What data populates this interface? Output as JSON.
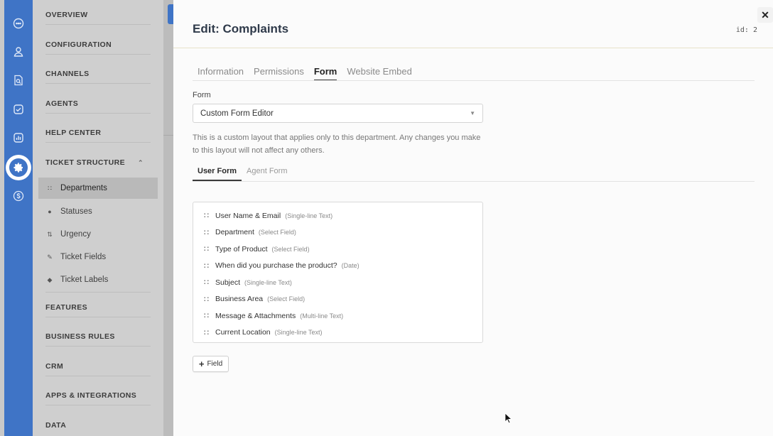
{
  "nav": {
    "sections": [
      {
        "label": "OVERVIEW"
      },
      {
        "label": "CONFIGURATION"
      },
      {
        "label": "CHANNELS"
      },
      {
        "label": "AGENTS"
      },
      {
        "label": "HELP CENTER"
      },
      {
        "label": "TICKET STRUCTURE",
        "expanded": true
      },
      {
        "label": "FEATURES"
      },
      {
        "label": "BUSINESS RULES"
      },
      {
        "label": "CRM"
      },
      {
        "label": "APPS & INTEGRATIONS"
      },
      {
        "label": "DATA"
      }
    ],
    "ticket_structure_items": [
      {
        "label": "Departments",
        "icon": "grid-icon",
        "active": true
      },
      {
        "label": "Statuses",
        "icon": "circle-icon"
      },
      {
        "label": "Urgency",
        "icon": "sort-icon"
      },
      {
        "label": "Ticket Fields",
        "icon": "edit-icon"
      },
      {
        "label": "Ticket Labels",
        "icon": "tag-icon"
      }
    ]
  },
  "rail": {
    "icons": [
      "chat-icon",
      "user-icon",
      "search-doc-icon",
      "check-icon",
      "chart-icon",
      "gear-icon",
      "billing-icon"
    ],
    "active_icon": "gear-icon",
    "accent": "#3f74c6"
  },
  "panel": {
    "title": "Edit: Complaints",
    "id_label": "id: 2",
    "close_label": "✕",
    "tabs": [
      {
        "label": "Information"
      },
      {
        "label": "Permissions"
      },
      {
        "label": "Form",
        "active": true
      },
      {
        "label": "Website Embed"
      }
    ],
    "form_label": "Form",
    "form_select_value": "Custom Form Editor",
    "description": "This is a custom layout that applies only to this department. Any changes you make to this layout will not affect any others.",
    "subtabs": [
      {
        "label": "User Form",
        "active": true
      },
      {
        "label": "Agent Form"
      }
    ],
    "fields": [
      {
        "name": "User Name & Email",
        "type": "(Single-line Text)"
      },
      {
        "name": "Department",
        "type": "(Select Field)"
      },
      {
        "name": "Type of Product",
        "type": "(Select Field)"
      },
      {
        "name": "When did you purchase the product?",
        "type": "(Date)"
      },
      {
        "name": "Subject",
        "type": "(Single-line Text)"
      },
      {
        "name": "Business Area",
        "type": "(Select Field)"
      },
      {
        "name": "Message & Attachments",
        "type": "(Multi-line Text)"
      },
      {
        "name": "Current Location",
        "type": "(Single-line Text)"
      }
    ],
    "add_field_label": "Field"
  }
}
